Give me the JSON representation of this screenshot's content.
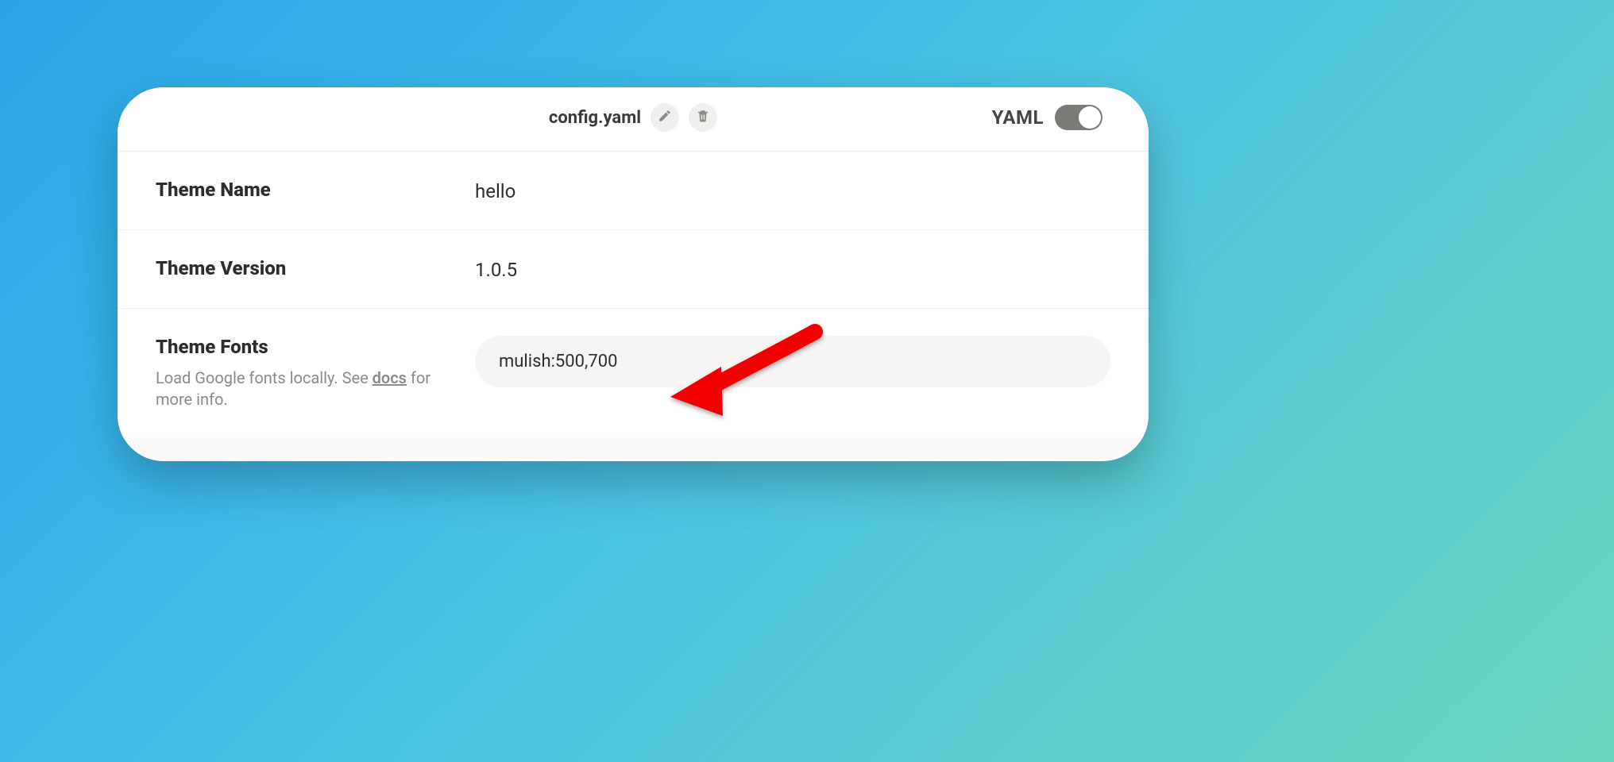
{
  "header": {
    "filename": "config.yaml",
    "yaml_label": "YAML"
  },
  "rows": {
    "theme_name": {
      "label": "Theme Name",
      "value": "hello"
    },
    "theme_version": {
      "label": "Theme Version",
      "value": "1.0.5"
    },
    "theme_fonts": {
      "label": "Theme Fonts",
      "help_pre": "Load Google fonts locally. See ",
      "help_link": "docs",
      "help_post": " for more info.",
      "value": "mulish:500,700"
    }
  }
}
